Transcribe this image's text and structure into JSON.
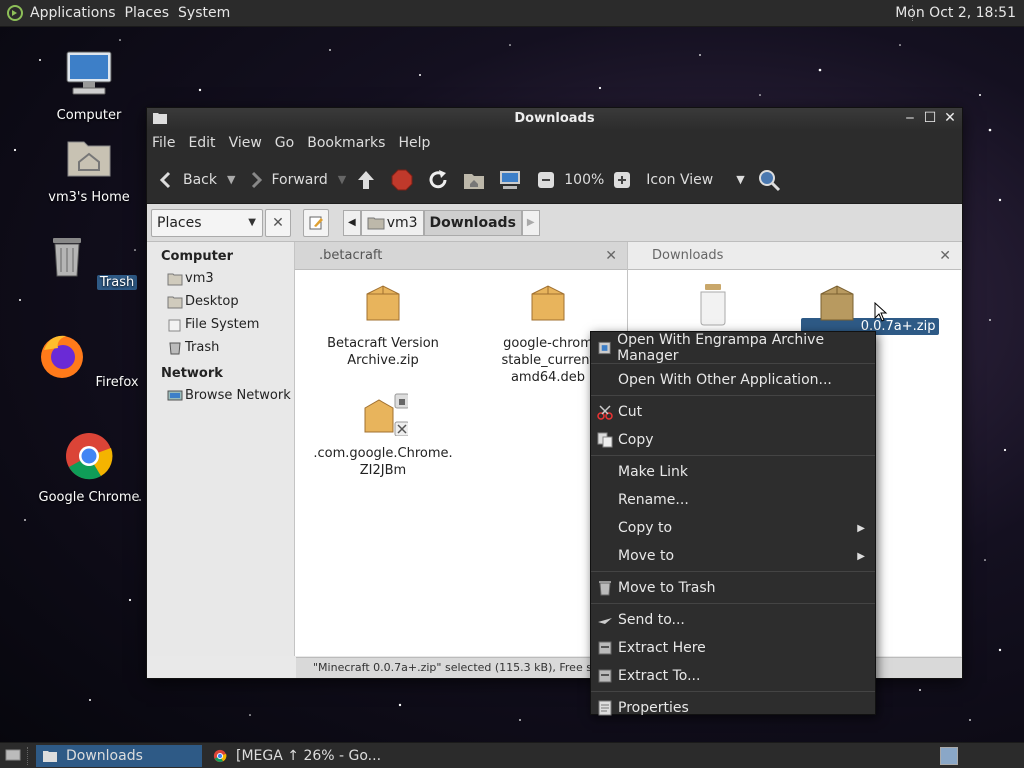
{
  "top_panel": {
    "menus": [
      "Applications",
      "Places",
      "System"
    ],
    "clock": "Mon Oct  2, 18:51"
  },
  "desktop": {
    "icons": [
      {
        "label": "Computer",
        "icon": "computer-icon"
      },
      {
        "label": "vm3's Home",
        "icon": "home-folder-icon"
      },
      {
        "label": "Trash",
        "icon": "trash-icon"
      },
      {
        "label": "Firefox",
        "icon": "firefox-icon"
      },
      {
        "label": "Google Chrome",
        "icon": "chrome-icon"
      }
    ]
  },
  "window": {
    "title": "Downloads",
    "menu": [
      "File",
      "Edit",
      "View",
      "Go",
      "Bookmarks",
      "Help"
    ],
    "toolbar": {
      "back": "Back",
      "forward": "Forward",
      "zoom": "100%",
      "view_mode": "Icon View"
    },
    "location": {
      "places": "Places",
      "crumbs": [
        "vm3",
        "Downloads"
      ]
    },
    "sidebar": {
      "computer_head": "Computer",
      "computer_items": [
        "vm3",
        "Desktop",
        "File System",
        "Trash"
      ],
      "network_head": "Network",
      "network_items": [
        "Browse Network"
      ]
    },
    "left_pane": {
      "tab": ".betacraft",
      "files": [
        {
          "line1": "Betacraft Version",
          "line2": "Archive.zip"
        },
        {
          "line1": "google-chrom",
          "line2": "stable_current",
          "line3": "amd64.deb"
        },
        {
          "line1": ".com.google.Chrome.",
          "line2": "ZI2JBm"
        }
      ]
    },
    "right_pane": {
      "tab": "Downloads",
      "selected_label": "0.0.7a+.zip"
    },
    "status": "\"Minecraft 0.0.7a+.zip\" selected (115.3 kB), Free space: 2"
  },
  "context_menu": {
    "items": [
      {
        "label": "Open With Engrampa Archive Manager",
        "icon": "archive-manager-icon"
      },
      {
        "label": "Open With Other Application...",
        "icon": ""
      },
      {
        "label": "Cut",
        "icon": "scissors-icon"
      },
      {
        "label": "Copy",
        "icon": "copy-icon"
      },
      {
        "label": "Make Link",
        "icon": ""
      },
      {
        "label": "Rename...",
        "icon": ""
      },
      {
        "label": "Copy to",
        "icon": "",
        "submenu": true
      },
      {
        "label": "Move to",
        "icon": "",
        "submenu": true
      },
      {
        "label": "Move to Trash",
        "icon": "trash-icon"
      },
      {
        "label": "Send to...",
        "icon": "send-icon"
      },
      {
        "label": "Extract Here",
        "icon": "extract-icon"
      },
      {
        "label": "Extract To...",
        "icon": "extract-icon"
      },
      {
        "label": "Properties",
        "icon": "properties-icon"
      }
    ]
  },
  "taskbar": {
    "tasks": [
      "Downloads",
      "[MEGA ↑ 26% - Go..."
    ]
  }
}
